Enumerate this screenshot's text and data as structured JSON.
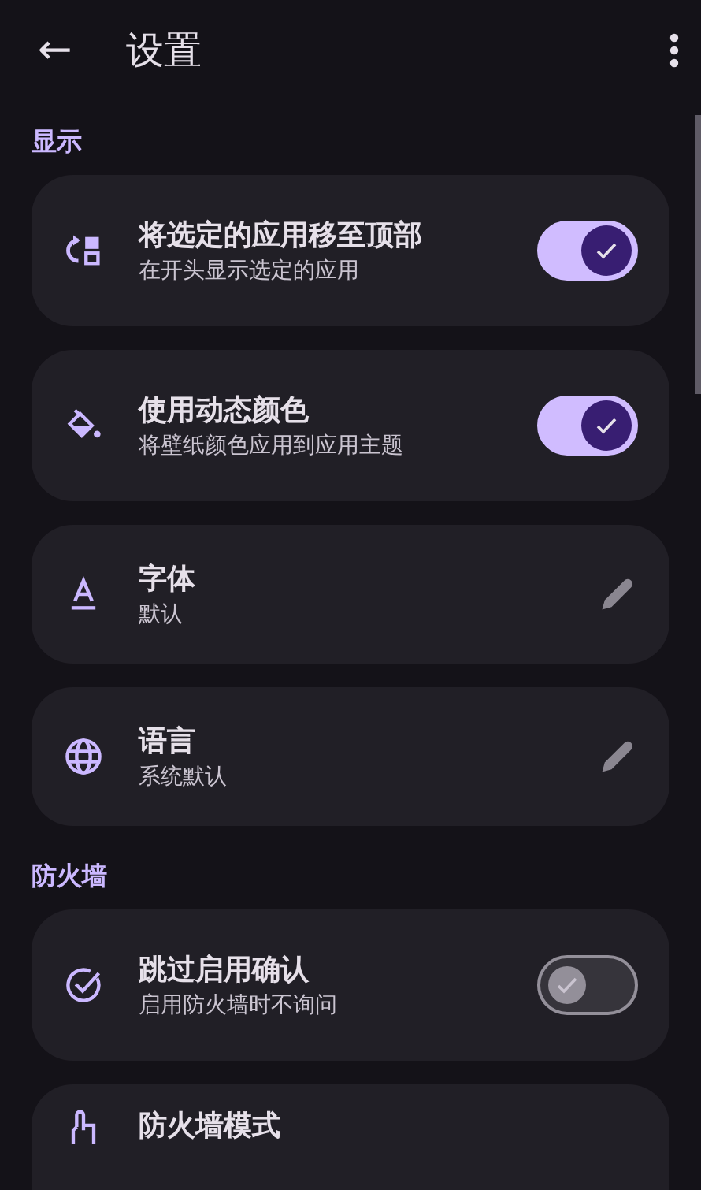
{
  "app_bar": {
    "back": "←",
    "title": "设置"
  },
  "sections": [
    {
      "title": "显示",
      "items": [
        {
          "kind": "toggle",
          "title": "将选定的应用移至顶部",
          "subtitle": "在开头显示选定的应用",
          "on": true
        },
        {
          "kind": "toggle",
          "title": "使用动态颜色",
          "subtitle": "将壁纸颜色应用到应用主题",
          "on": true
        },
        {
          "kind": "edit",
          "title": "字体",
          "subtitle": "默认"
        },
        {
          "kind": "edit",
          "title": "语言",
          "subtitle": "系统默认"
        }
      ]
    },
    {
      "title": "防火墙",
      "items": [
        {
          "kind": "toggle",
          "title": "跳过启用确认",
          "subtitle": "启用防火墙时不询问",
          "on": false
        },
        {
          "kind": "plain",
          "title": "防火墙模式"
        }
      ]
    }
  ]
}
